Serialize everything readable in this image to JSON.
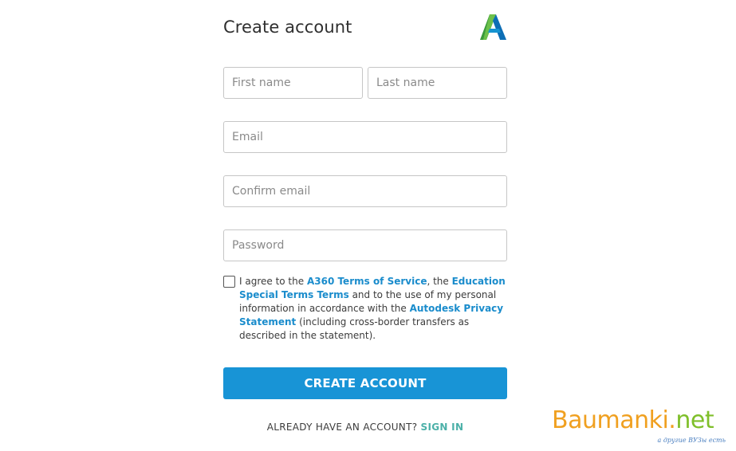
{
  "header": {
    "title": "Create account",
    "logo": "autodesk-logo"
  },
  "fields": {
    "first_name_placeholder": "First name",
    "last_name_placeholder": "Last name",
    "email_placeholder": "Email",
    "confirm_email_placeholder": "Confirm email",
    "password_placeholder": "Password"
  },
  "agreement": {
    "checked": false,
    "text_1": "I agree to the ",
    "link_1": "A360 Terms of Service",
    "text_2": ", the ",
    "link_2": "Education Special Terms Terms",
    "text_3": " and to the use of my personal information in accordance with the ",
    "link_3": "Autodesk Privacy Statement",
    "text_4": " (including cross-border transfers as described in the statement)."
  },
  "actions": {
    "create_label": "CREATE ACCOUNT",
    "already_text": "ALREADY HAVE AN ACCOUNT? ",
    "signin_label": "SIGN IN"
  },
  "watermark": {
    "main": "Baumanki.",
    "accent": "net",
    "sub": "а другие ВУЗы есть"
  },
  "colors": {
    "primary_button": "#1894d6",
    "link": "#1a8ccc",
    "signin_link": "#4bb0a8"
  }
}
